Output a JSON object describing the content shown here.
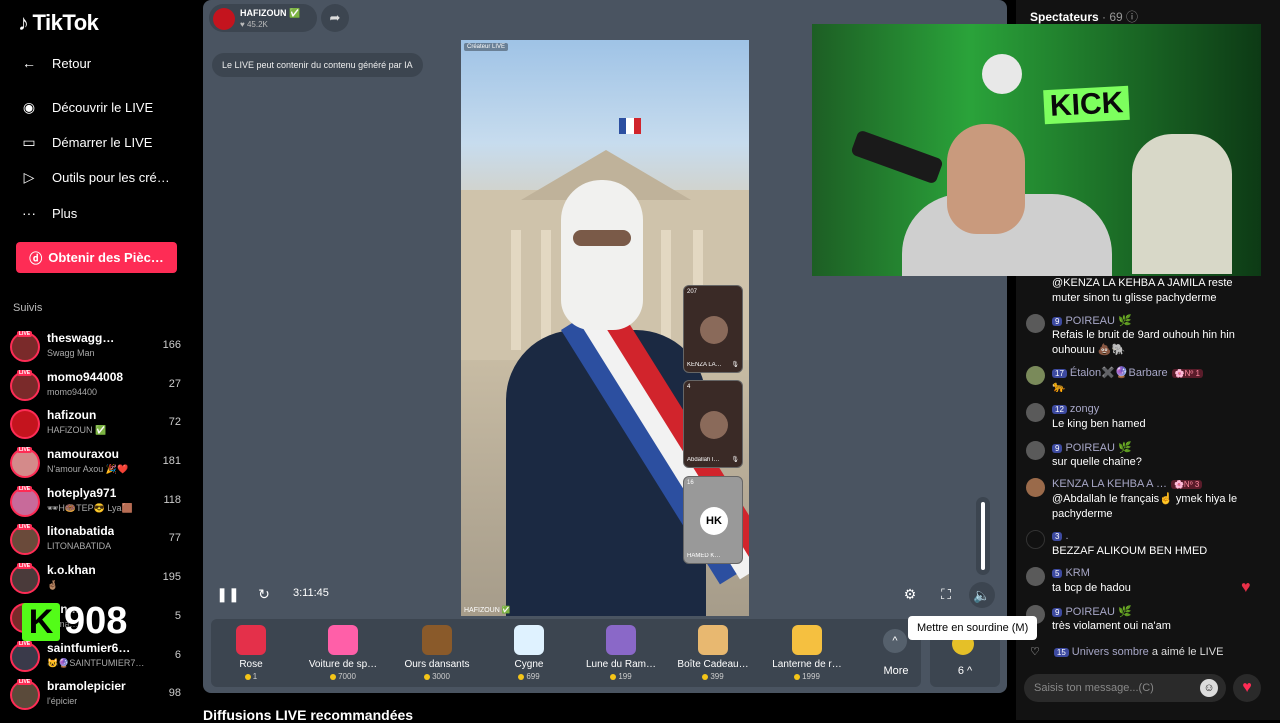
{
  "app": {
    "brand": "TikTok"
  },
  "nav": {
    "back": "Retour",
    "discover": "Découvrir le LIVE",
    "start": "Démarrer le LIVE",
    "tools": "Outils pour les cré…",
    "more": "Plus",
    "coins_button": "Obtenir des Pièc…"
  },
  "following": {
    "heading": "Suivis",
    "items": [
      {
        "name": "theswagg…",
        "sub": "Swagg Man",
        "count": "166"
      },
      {
        "name": "momo944008",
        "sub": "momo94400",
        "count": "27"
      },
      {
        "name": "hafizoun",
        "sub": "HAFiZOUN ✅",
        "count": "72"
      },
      {
        "name": "namouraxou",
        "sub": "N'amour Axou 🎉❤️",
        "count": "181"
      },
      {
        "name": "hoteplya971",
        "sub": "🕶H🍩TEP😎 Lya🟫",
        "count": "118"
      },
      {
        "name": "litonabatida",
        "sub": "LITONABATIDA",
        "count": "77"
      },
      {
        "name": "k.o.khan",
        "sub": "🤞🏽",
        "count": "195"
      },
      {
        "name": "00n…",
        "sub": "00ma…",
        "count": "5"
      },
      {
        "name": "saintfumier6…",
        "sub": "😺🔮SAINTFUMIER7…",
        "count": "6"
      },
      {
        "name": "bramolepicier",
        "sub": "l'épicier",
        "count": "98"
      }
    ],
    "watermark": "908",
    "watermark_k": "K"
  },
  "player": {
    "host_name": "HAFIZOUN ✅",
    "host_likes": "♥ 45.2K",
    "ai_notice": "Le LIVE peut contenir du contenu généré par IA",
    "creator_tag": "Créateur LIVE",
    "host_label": "HAFIZOUN ✅",
    "time": "3:11:45",
    "tooltip": "Mettre en sourdine (M)",
    "guests": [
      {
        "count": "207",
        "name": "KENZA LA…"
      },
      {
        "count": "4",
        "name": "Abdallah l…"
      },
      {
        "count": "16",
        "name": "HAMED K…"
      }
    ]
  },
  "gifts": [
    {
      "name": "Rose",
      "price": "1",
      "color": "#e4304a"
    },
    {
      "name": "Voiture de sp…",
      "price": "7000",
      "color": "#ff5fa8"
    },
    {
      "name": "Ours dansants",
      "price": "3000",
      "color": "#8a5a2a"
    },
    {
      "name": "Cygne",
      "price": "699",
      "color": "#dff2ff"
    },
    {
      "name": "Lune du Ram…",
      "price": "199",
      "color": "#8a68c8"
    },
    {
      "name": "Boîte Cadeau…",
      "price": "399",
      "color": "#e8b870"
    },
    {
      "name": "Lanterne de r…",
      "price": "1999",
      "color": "#f5c040"
    }
  ],
  "gift_more": "More",
  "coin_balance": "6 ^",
  "recommended_heading": "Diffusions LIVE recommandées",
  "chat": {
    "viewers_label": "Spectateurs",
    "viewers_count": "· 69 ⓘ",
    "kick_sign": "KICK",
    "messages": [
      {
        "level": "",
        "user": "",
        "rank": "",
        "text": "@KENZA LA KEHBA A JAMILA reste muter sinon tu glisse pachyderme"
      },
      {
        "level": "9",
        "user": "POIREAU 🌿",
        "rank": "",
        "text": "Refais le bruit de 9ard ouhouh hin hin ouhouuu 💩🐘"
      },
      {
        "level": "17",
        "user": "Étalon✖️🔮Barbare",
        "rank": "🌸Nº 1",
        "text": "🐆"
      },
      {
        "level": "12",
        "user": "zongy",
        "rank": "",
        "text": "Le king ben hamed"
      },
      {
        "level": "9",
        "user": "POIREAU 🌿",
        "rank": "",
        "text": "sur quelle chaîne?"
      },
      {
        "level": "",
        "user": "KENZA LA KEHBA A …",
        "rank": "🌸Nº 3",
        "text": "@Abdallah le français☝️ ymek hiya le pachyderme"
      },
      {
        "level": "3",
        "user": ".",
        "rank": "",
        "text": "BEZZAF ALIKOUM BEN HMED"
      },
      {
        "level": "5",
        "user": "KRM",
        "rank": "",
        "text": "ta bcp de hadou"
      },
      {
        "level": "9",
        "user": "POIREAU 🌿",
        "rank": "",
        "text": "très violament oui na'am"
      }
    ],
    "liked": {
      "level": "15",
      "user": "Univers sombre",
      "text": "a aimé le LIVE"
    },
    "input_placeholder": "Saisis ton message...(C)"
  }
}
